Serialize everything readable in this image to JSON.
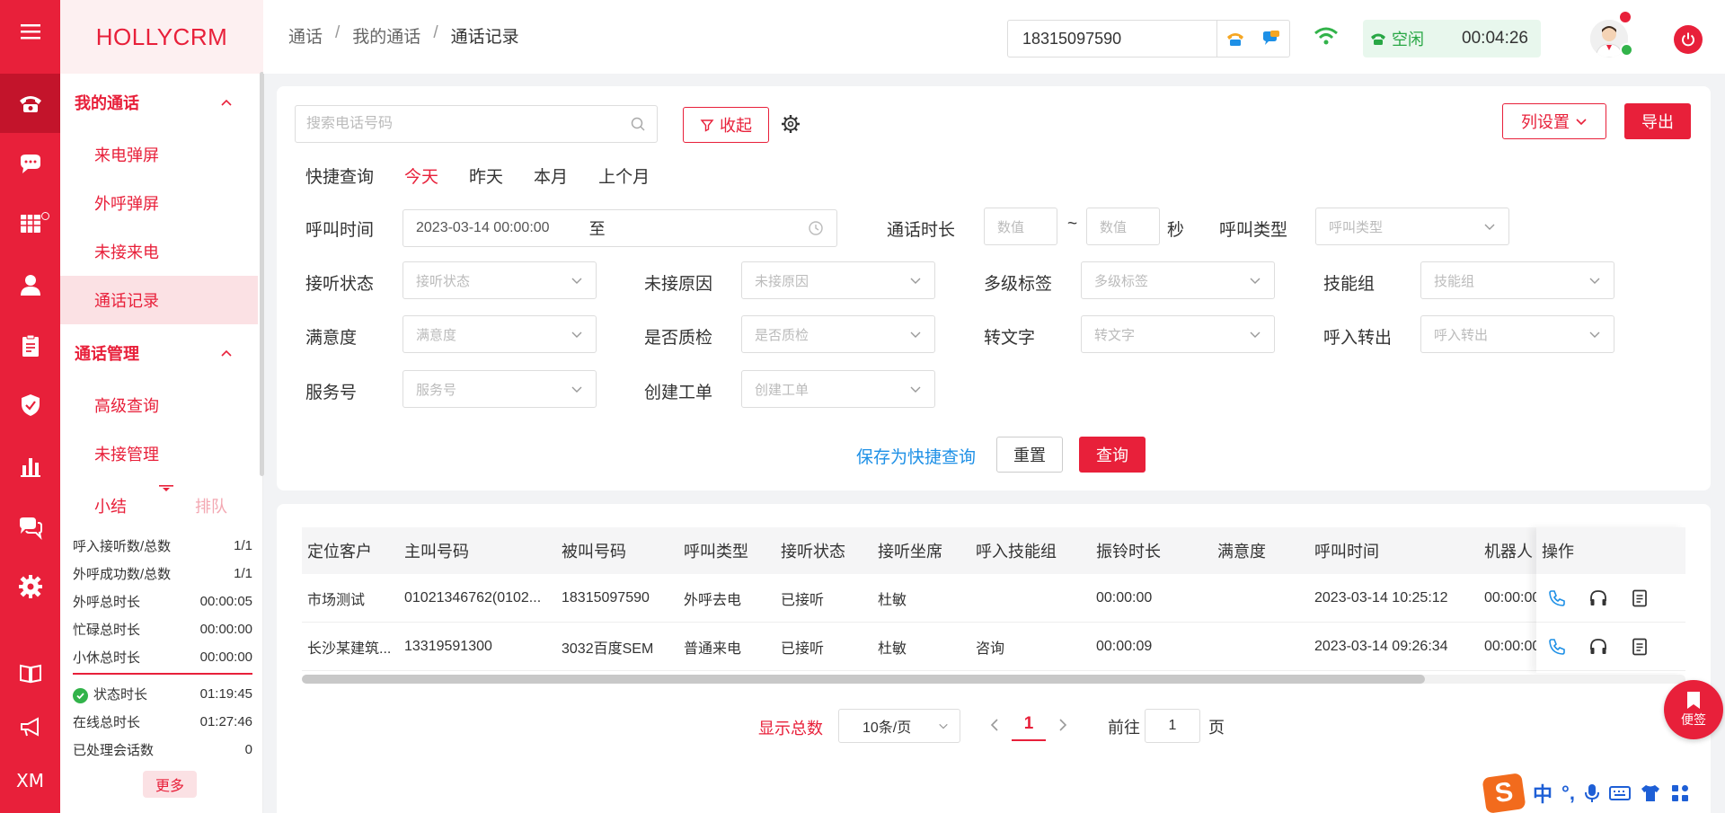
{
  "app": {
    "logo": "HOLLYCRM"
  },
  "rail": {
    "bottom_label": "XM"
  },
  "menu": {
    "groups": [
      {
        "label": "我的通话",
        "items": [
          "来电弹屏",
          "外呼弹屏",
          "未接来电",
          "通话记录"
        ]
      },
      {
        "label": "通话管理",
        "items": [
          "高级查询",
          "未接管理"
        ]
      }
    ],
    "active_item": "通话记录"
  },
  "summary": {
    "tab_active": "小结",
    "tab_inactive": "排队",
    "stats": [
      {
        "label": "呼入接听数/总数",
        "value": "1/1"
      },
      {
        "label": "外呼成功数/总数",
        "value": "1/1"
      },
      {
        "label": "外呼总时长",
        "value": "00:00:05"
      },
      {
        "label": "忙碌总时长",
        "value": "00:00:00"
      },
      {
        "label": "小休总时长",
        "value": "00:00:00"
      }
    ],
    "stats2": [
      {
        "label": "状态时长",
        "value": "01:19:45"
      },
      {
        "label": "在线总时长",
        "value": "01:27:46"
      },
      {
        "label": "已处理会话数",
        "value": "0"
      }
    ],
    "more": "更多"
  },
  "header": {
    "breadcrumb": [
      "通话",
      "我的通话",
      "通话记录"
    ],
    "sep": "/",
    "phone": "18315097590",
    "status": "空闲",
    "timer": "00:04:26"
  },
  "filter": {
    "search_placeholder": "搜索电话号码",
    "collapse": "收起",
    "column_settings": "列设置",
    "export": "导出",
    "quick_label": "快捷查询",
    "quick_options": [
      "今天",
      "昨天",
      "本月",
      "上个月"
    ],
    "call_time_label": "呼叫时间",
    "call_time_start": "2023-03-14 00:00:00",
    "call_time_to": "至",
    "duration_label": "通话时长",
    "num_placeholder": "数值",
    "tilde": "~",
    "seconds": "秒",
    "call_type_label": "呼叫类型",
    "call_type_ph": "呼叫类型",
    "answer_status_label": "接听状态",
    "answer_status_ph": "接听状态",
    "missed_reason_label": "未接原因",
    "missed_reason_ph": "未接原因",
    "tags_label": "多级标签",
    "tags_ph": "多级标签",
    "skill_group_label": "技能组",
    "skill_group_ph": "技能组",
    "satisfaction_label": "满意度",
    "satisfaction_ph": "满意度",
    "qc_label": "是否质检",
    "qc_ph": "是否质检",
    "to_text_label": "转文字",
    "to_text_ph": "转文字",
    "transfer_label": "呼入转出",
    "transfer_ph": "呼入转出",
    "service_no_label": "服务号",
    "service_no_ph": "服务号",
    "ticket_label": "创建工单",
    "ticket_ph": "创建工单",
    "save_quick": "保存为快捷查询",
    "reset": "重置",
    "query": "查询"
  },
  "table": {
    "headers": [
      "定位客户",
      "主叫号码",
      "被叫号码",
      "呼叫类型",
      "接听状态",
      "接听坐席",
      "呼入技能组",
      "振铃时长",
      "满意度",
      "呼叫时间",
      "机器人"
    ],
    "ops_header": "操作",
    "rows": [
      [
        "市场测试",
        "01021346762(0102...",
        "18315097590",
        "外呼去电",
        "已接听",
        "杜敏",
        "",
        "00:00:00",
        "",
        "2023-03-14 10:25:12",
        "00:00:00"
      ],
      [
        "长沙某建筑...",
        "13319591300",
        "3032百度SEM",
        "普通来电",
        "已接听",
        "杜敏",
        "咨询",
        "00:00:09",
        "",
        "2023-03-14 09:26:34",
        "00:00:00"
      ]
    ]
  },
  "pager": {
    "total_label": "显示总数",
    "page_size": "10条/页",
    "current": "1",
    "goto_label": "前往",
    "goto_value": "1",
    "page_word": "页"
  },
  "note_button": "便签",
  "ime": {
    "s": "S",
    "zh": "中",
    "punc": "°,"
  },
  "colors": {
    "brand": "#e8203a",
    "status_green": "#28a745",
    "link_blue": "#1e90e6"
  }
}
